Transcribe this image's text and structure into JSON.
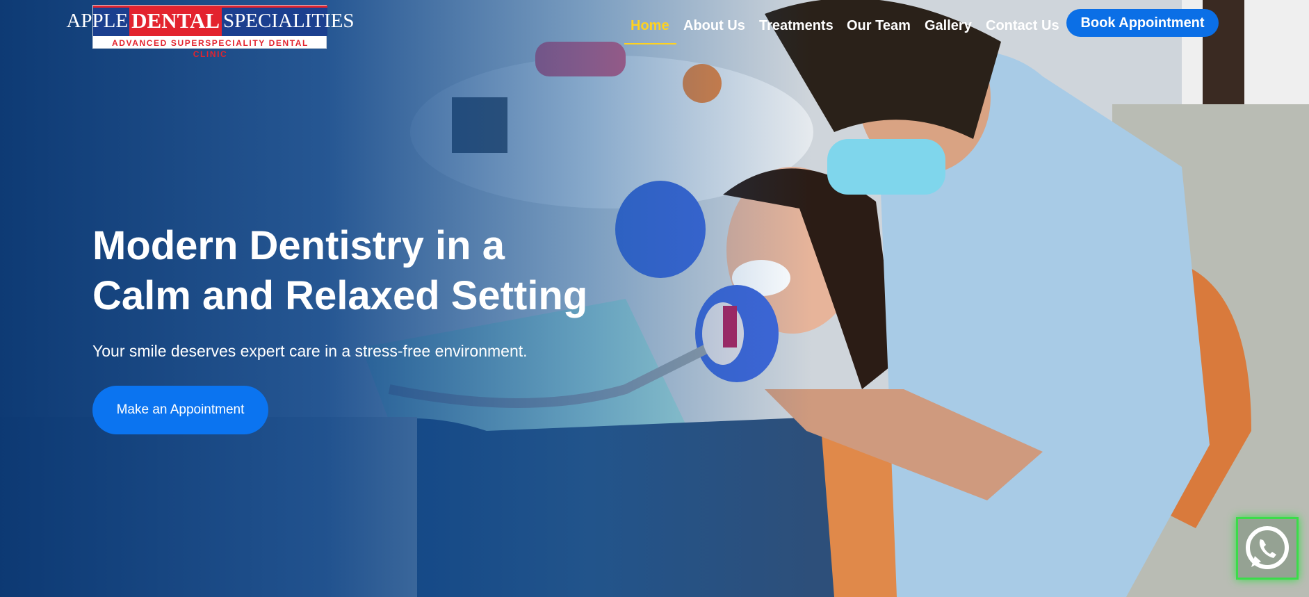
{
  "brand": {
    "logo_word_1": "APPLE",
    "logo_word_2": "DENTAL",
    "logo_word_3": "SPECIALITIES",
    "tagline": "ADVANCED SUPERSPECIALITY DENTAL CLINIC"
  },
  "nav": {
    "items": [
      {
        "label": "Home"
      },
      {
        "label": "About Us"
      },
      {
        "label": "Treatments"
      },
      {
        "label": "Our Team"
      },
      {
        "label": "Gallery"
      },
      {
        "label": "Contact Us"
      }
    ],
    "book_label": "Book Appointment"
  },
  "hero": {
    "headline_line1": "Modern Dentistry in a",
    "headline_line2": "Calm and Relaxed Setting",
    "subtitle": "Your smile deserves expert care in a stress-free environment.",
    "cta_label": "Make an Appointment"
  },
  "icons": {
    "whatsapp": "whatsapp-icon"
  },
  "colors": {
    "accent": "#0b6fe6",
    "active_nav": "#ffd21f",
    "overlay": "#063470",
    "whatsapp_glow": "#3bdc4a"
  }
}
